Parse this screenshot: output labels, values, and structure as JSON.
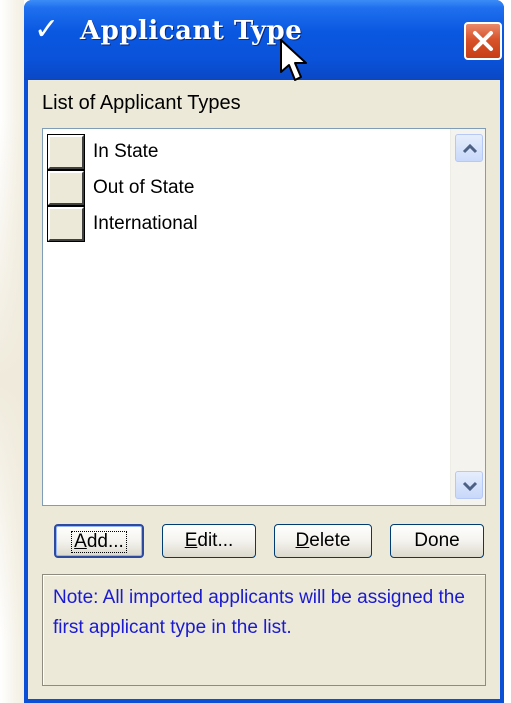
{
  "window": {
    "title_check": "✓",
    "title": "Applicant Type",
    "close_icon": "close-icon"
  },
  "list": {
    "label": "List of Applicant Types",
    "items": [
      {
        "label": "In State"
      },
      {
        "label": "Out of State"
      },
      {
        "label": "International"
      }
    ]
  },
  "buttons": {
    "add": {
      "pre": "",
      "key": "A",
      "post": "dd..."
    },
    "edit": {
      "pre": "",
      "key": "E",
      "post": "dit..."
    },
    "delete": {
      "pre": "",
      "key": "D",
      "post": "elete"
    },
    "done": {
      "label": "Done"
    }
  },
  "note": {
    "text": "Note:  All imported applicants will be assigned the first applicant type in the list."
  },
  "colors": {
    "titlebar": "#0a52d9",
    "window_border": "#0a4fd6",
    "dialog_bg": "#ece9d8",
    "note_text": "#1a1ad0",
    "close_button": "#d8532a"
  }
}
